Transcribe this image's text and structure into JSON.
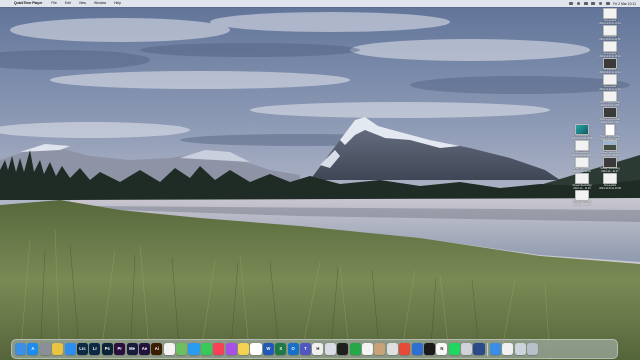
{
  "menubar": {
    "app_name": "QuickTime Player",
    "items": [
      "File",
      "Edit",
      "View",
      "Window",
      "Help"
    ],
    "clock": "Fri 2 Mar 10:11"
  },
  "desktop_icons": [
    {
      "label": "Screenshot",
      "date": "2024-11-05 at 10.33",
      "style": "plain"
    },
    {
      "label": "Screenshot",
      "date": "2024-11-06 at 11.58",
      "style": "plain"
    },
    {
      "label": "Screenshot",
      "date": "2024-11-20 at 16.04",
      "style": "plain"
    },
    {
      "label": "Screenshot",
      "date": "2024-11-22 at 14.41",
      "style": "dark"
    },
    {
      "label": "Screenshot",
      "date": "2024-11-23 at 10.49",
      "style": "plain"
    },
    {
      "label": "How to get a white",
      "date": "background...000",
      "style": "plain"
    },
    {
      "label": "How to get a white",
      "date": "background...000",
      "style": "dark"
    },
    {
      "label": "How to get a white",
      "date": "background...000",
      "style": "doc"
    },
    {
      "label": "Screen Recording",
      "date": "2024-11-...12.30",
      "style": "landscape"
    },
    {
      "label": "Screen Recording",
      "date": "2024-11-...11.47",
      "style": "dark"
    },
    {
      "label": "Screenshot",
      "date": "2024-12-03 at 10.38",
      "style": "plain"
    },
    {
      "label": "Screenshot",
      "date": "2024-12-03 at 10.39",
      "style": "teal"
    },
    {
      "label": "Screenshot",
      "date": "2024-12-05 at 09.16",
      "style": "plain"
    },
    {
      "label": "Screen Recording",
      "date": "2024-11-...10.30",
      "style": "plain"
    },
    {
      "label": "Screen Recording",
      "date": "2024-11-...11.06",
      "style": "plain"
    },
    {
      "label": "Screen Recording",
      "date": "2024-11-...12.19",
      "style": "plain"
    }
  ],
  "dock": {
    "apps": [
      {
        "name": "Finder",
        "abbr": "",
        "color": "#3d8fe6"
      },
      {
        "name": "App Store",
        "abbr": "A",
        "color": "#1c8cf0"
      },
      {
        "name": "Launchpad",
        "abbr": "",
        "color": "#8a8f99"
      },
      {
        "name": "Chrome",
        "abbr": "",
        "color": "#e8c440"
      },
      {
        "name": "Mail",
        "abbr": "",
        "color": "#2f8df0"
      },
      {
        "name": "Lightroom Classic",
        "abbr": "Lrc",
        "color": "#0d2a44"
      },
      {
        "name": "Lightroom",
        "abbr": "Lr",
        "color": "#0d2a44"
      },
      {
        "name": "Photoshop",
        "abbr": "Ps",
        "color": "#0b2438"
      },
      {
        "name": "Premiere Pro",
        "abbr": "Pr",
        "color": "#2a0d3d"
      },
      {
        "name": "Media Encoder",
        "abbr": "Me",
        "color": "#1a1a3e"
      },
      {
        "name": "After Effects",
        "abbr": "Ae",
        "color": "#22123e"
      },
      {
        "name": "Illustrator",
        "abbr": "Ai",
        "color": "#3a1d00"
      },
      {
        "name": "Photos",
        "abbr": "",
        "color": "#f4f4f4"
      },
      {
        "name": "Maps",
        "abbr": "",
        "color": "#6dbf62"
      },
      {
        "name": "Safari",
        "abbr": "",
        "color": "#2a9cf0"
      },
      {
        "name": "Messages",
        "abbr": "",
        "color": "#37c95a"
      },
      {
        "name": "Music",
        "abbr": "",
        "color": "#f74156"
      },
      {
        "name": "Podcasts",
        "abbr": "",
        "color": "#a850e8"
      },
      {
        "name": "Notes",
        "abbr": "",
        "color": "#f5d352"
      },
      {
        "name": "Calendar",
        "abbr": "",
        "color": "#ffffff"
      },
      {
        "name": "Word",
        "abbr": "W",
        "color": "#2058b8"
      },
      {
        "name": "Excel",
        "abbr": "X",
        "color": "#1e7a44"
      },
      {
        "name": "Outlook",
        "abbr": "O",
        "color": "#1470c8"
      },
      {
        "name": "Teams",
        "abbr": "T",
        "color": "#5058c0"
      },
      {
        "name": "Hemingway",
        "abbr": "H",
        "color": "#f0f0f0"
      },
      {
        "name": "Preview",
        "abbr": "",
        "color": "#d8dde6"
      },
      {
        "name": "Clock",
        "abbr": "",
        "color": "#202020"
      },
      {
        "name": "Evernote",
        "abbr": "",
        "color": "#25a84a"
      },
      {
        "name": "Reminders",
        "abbr": "",
        "color": "#f4f4f4"
      },
      {
        "name": "Contacts",
        "abbr": "",
        "color": "#c8a37a"
      },
      {
        "name": "Activity Monitor",
        "abbr": "",
        "color": "#e0e0e0"
      },
      {
        "name": "Google Chrome",
        "abbr": "",
        "color": "#e84a3a"
      },
      {
        "name": "VPN",
        "abbr": "",
        "color": "#2f6fcf"
      },
      {
        "name": "CleanMyMac",
        "abbr": "",
        "color": "#1a1a1a"
      },
      {
        "name": "Notion",
        "abbr": "N",
        "color": "#f8f8f8"
      },
      {
        "name": "Spotify",
        "abbr": "",
        "color": "#1ed760"
      },
      {
        "name": "Discord",
        "abbr": "",
        "color": "#d0d4da"
      },
      {
        "name": "QuickTime Player",
        "abbr": "",
        "color": "#2a4a8a"
      }
    ],
    "trailing": [
      {
        "name": "Downloads",
        "abbr": "",
        "color": "#3c8de8"
      },
      {
        "name": "Document",
        "abbr": "",
        "color": "#f0f0f0"
      },
      {
        "name": "Screenshot stack",
        "abbr": "",
        "color": "#cfd4dc"
      },
      {
        "name": "Trash",
        "abbr": "",
        "color": "#b8bfc8"
      }
    ]
  },
  "colors": {
    "sky_top": "#6f83a6",
    "sky_mid": "#b7bfcf",
    "mountain": "#5b6474",
    "snow": "#e9eef6",
    "trees": "#1c2a22",
    "water": "#a7b3c6",
    "grass": "#6d7a4a"
  }
}
